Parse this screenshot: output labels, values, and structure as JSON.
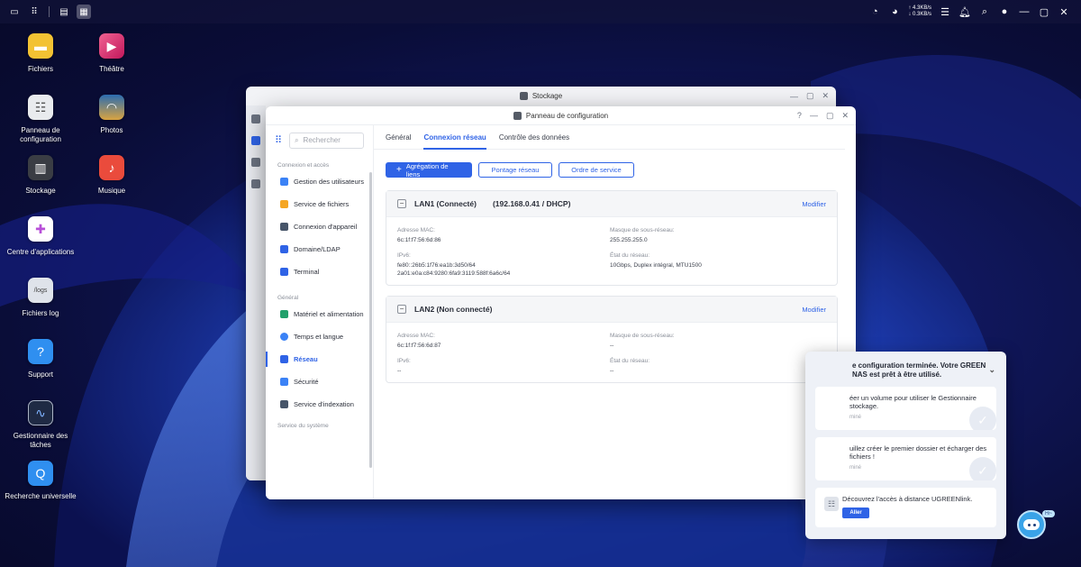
{
  "topbar": {
    "speed_up": "↑ 4.3KB/s",
    "speed_down": "↓ 0.3KB/s"
  },
  "desktop": [
    {
      "label": "Fichiers",
      "icon": "folder-icon",
      "color": "#f3c233"
    },
    {
      "label": "Théâtre",
      "icon": "clapperboard-icon",
      "color": "#e84c7a"
    },
    {
      "label": "Panneau de configuration",
      "icon": "control-panel-icon",
      "color": "#e9ebee"
    },
    {
      "label": "Photos",
      "icon": "photos-icon",
      "color": "#2b6cb0"
    },
    {
      "label": "Stockage",
      "icon": "storage-icon",
      "color": "#3a3d44"
    },
    {
      "label": "Musique",
      "icon": "music-icon",
      "color": "#ea4b3c"
    },
    {
      "label": "Centre d'applications",
      "icon": "app-center-icon",
      "color": "#ffffff"
    },
    {
      "label": "Fichiers log",
      "icon": "logs-icon",
      "color": "#dfe3ea"
    },
    {
      "label": "Support",
      "icon": "support-icon",
      "color": "#2f8ff0"
    },
    {
      "label": "Gestionnaire des tâches",
      "icon": "task-manager-icon",
      "color": "#1f2a44"
    },
    {
      "label": "Recherche universelle",
      "icon": "universal-search-icon",
      "color": "#2f8ff0"
    }
  ],
  "logs_tile_text": "/logs",
  "storage_window": {
    "title": "Stockage"
  },
  "config_window": {
    "title": "Panneau de configuration",
    "help": "?",
    "search_placeholder": "Rechercher",
    "sections": {
      "connexion": "Connexion et accès",
      "general": "Général",
      "service": "Service du système"
    },
    "nav": [
      {
        "label": "Gestion des utilisateurs",
        "icon": "users-icon",
        "color": "#3b82f6"
      },
      {
        "label": "Service de fichiers",
        "icon": "folder-icon",
        "color": "#f5a623"
      },
      {
        "label": "Connexion d'appareil",
        "icon": "device-icon",
        "color": "#475569"
      },
      {
        "label": "Domaine/LDAP",
        "icon": "domain-icon",
        "color": "#2f63e6"
      },
      {
        "label": "Terminal",
        "icon": "terminal-icon",
        "color": "#2f63e6"
      },
      {
        "label": "Matériel et alimentation",
        "icon": "hardware-icon",
        "color": "#22a06b"
      },
      {
        "label": "Temps et langue",
        "icon": "globe-icon",
        "color": "#3b82f6"
      },
      {
        "label": "Réseau",
        "icon": "network-icon",
        "color": "#2f63e6"
      },
      {
        "label": "Sécurité",
        "icon": "shield-icon",
        "color": "#3b82f6"
      },
      {
        "label": "Service d'indexation",
        "icon": "index-icon",
        "color": "#475569"
      }
    ],
    "tabs": [
      "Général",
      "Connexion réseau",
      "Contrôle des données"
    ],
    "buttons": {
      "aggregation": "Agrégation de liens",
      "bridge": "Pontage réseau",
      "service_order": "Ordre de service"
    },
    "lan1": {
      "title": "LAN1 (Connecté)",
      "ip": "(192.168.0.41 / DHCP)",
      "modify": "Modifier",
      "mac_label": "Adresse MAC:",
      "mac": "6c:1f:f7:56:6d:86",
      "mask_label": "Masque de sous-réseau:",
      "mask": "255.255.255.0",
      "ipv6_label": "IPv6:",
      "ipv6_1": "fe80::26b5:1f76:ea1b:3d50/64",
      "ipv6_2": "2a01:e0a:c84:9280:6fa9:3119:588f:6a6c/64",
      "state_label": "État du réseau:",
      "state": "10Gbps,  Duplex intégral,  MTU1500"
    },
    "lan2": {
      "title": "LAN2 (Non connecté)",
      "modify": "Modifier",
      "mac_label": "Adresse MAC:",
      "mac": "6c:1f:f7:56:6d:87",
      "mask_label": "Masque de sous-réseau:",
      "mask": "--",
      "ipv6_label": "IPv6:",
      "ipv6": "--",
      "state_label": "État du réseau:",
      "state": "--"
    }
  },
  "notification": {
    "title": "e configuration terminée. Votre GREEN NAS est prêt à être utilisé.",
    "items": [
      {
        "text": "éer un volume pour utiliser le Gestionnaire stockage.",
        "status": "miné"
      },
      {
        "text": "uillez créer le premier dossier et écharger des fichiers !",
        "status": "miné"
      }
    ],
    "remote": {
      "text": "Découvrez l'accès à distance UGREENlink.",
      "button": "Aller"
    }
  },
  "assistant_badge": "Hi~",
  "colors": {
    "accent": "#2f63e6"
  }
}
